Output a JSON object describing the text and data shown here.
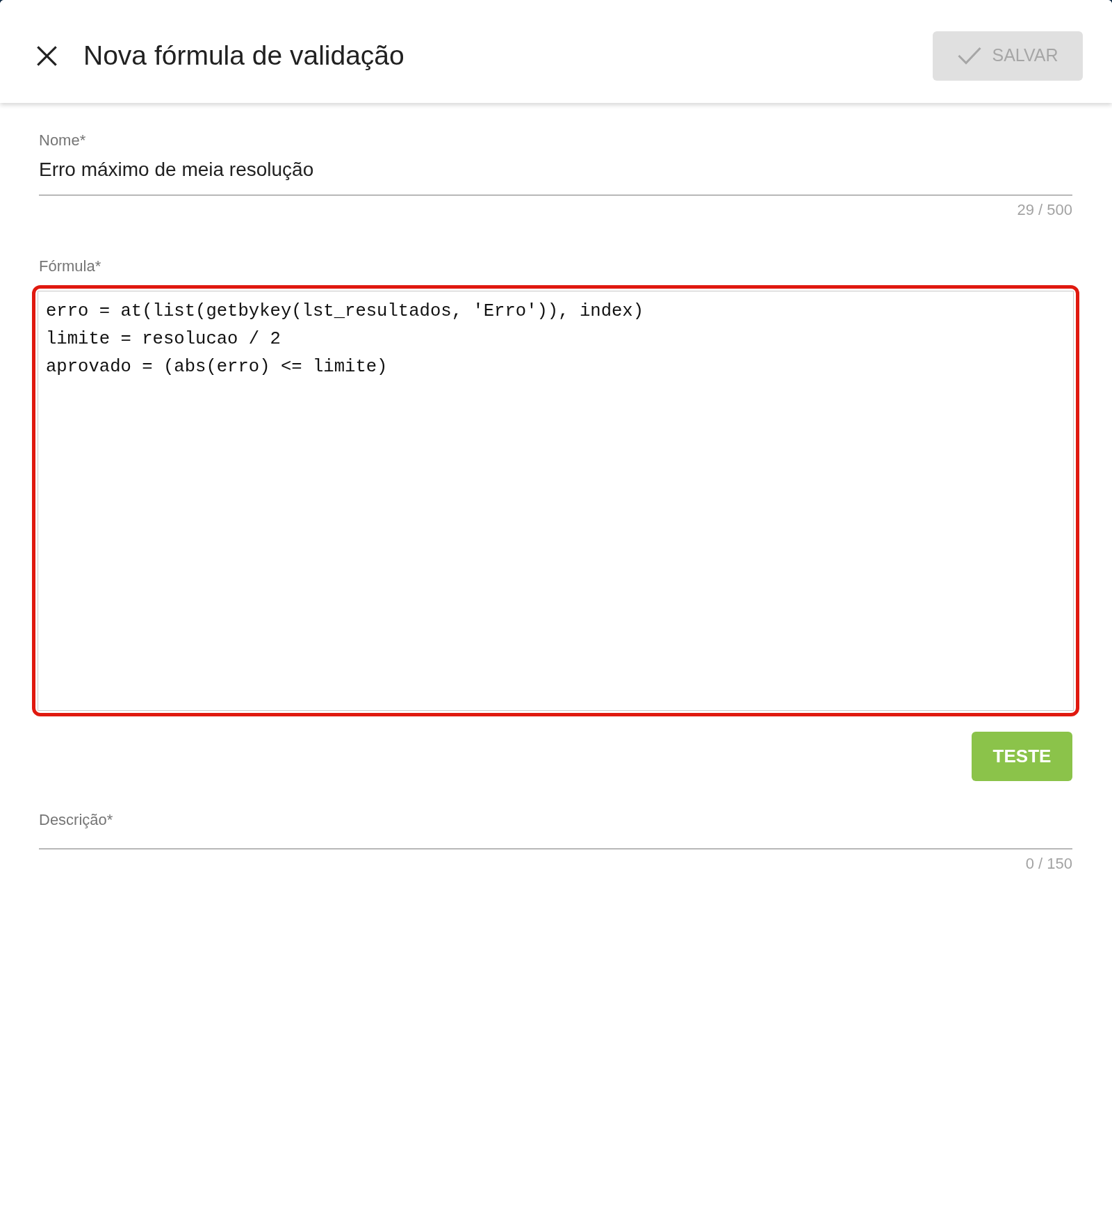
{
  "header": {
    "title": "Nova fórmula de validação",
    "save_button": {
      "label": "SALVAR",
      "disabled": true
    }
  },
  "name_field": {
    "label": "Nome*",
    "value": "Erro máximo de meia resolução",
    "counter": "29 / 500"
  },
  "formula_field": {
    "label": "Fórmula*",
    "value": "erro = at(list(getbykey(lst_resultados, 'Erro')), index)\nlimite = resolucao / 2\naprovado = (abs(erro) <= limite)",
    "highlighted": true
  },
  "test_button": {
    "label": "TESTE"
  },
  "description_field": {
    "label": "Descrição*",
    "counter": "0 / 150"
  }
}
